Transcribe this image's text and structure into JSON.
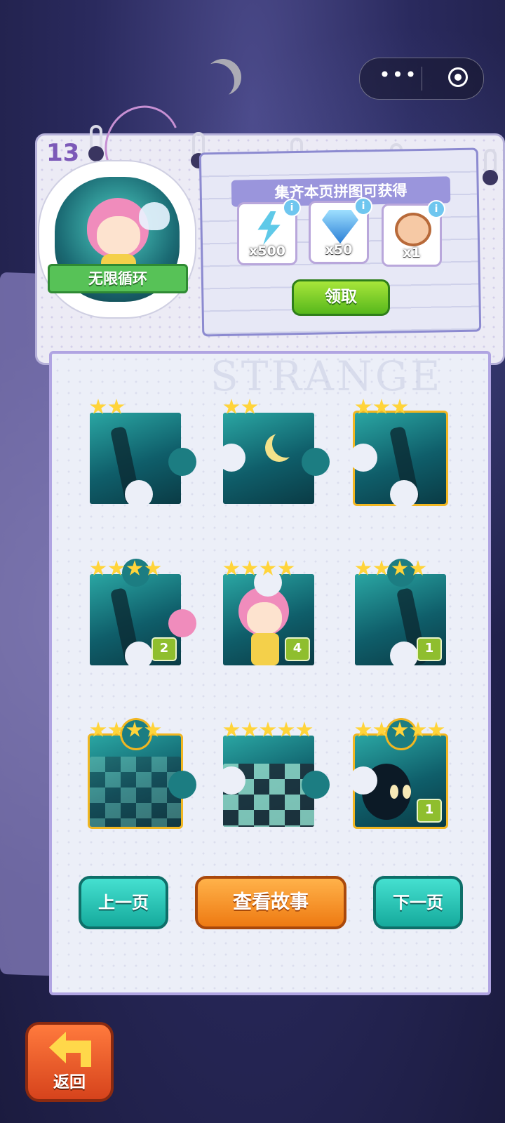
{
  "header": {
    "page_number": "13",
    "badge_title": "无限循环"
  },
  "rewards": {
    "title": "集齐本页拼图可获得",
    "items": [
      {
        "icon": "lightning-energy-icon",
        "quantity": "x500",
        "info": "i"
      },
      {
        "icon": "diamond-icon",
        "quantity": "x50",
        "info": "i"
      },
      {
        "icon": "alarm-clock-icon",
        "quantity": "x1",
        "info": "i"
      }
    ],
    "claim_label": "领取"
  },
  "puzzle": {
    "watermark": "STRANGE",
    "pieces": [
      {
        "stars": 2,
        "count": ""
      },
      {
        "stars": 2,
        "count": ""
      },
      {
        "stars": 3,
        "count": ""
      },
      {
        "stars": 4,
        "count": "2"
      },
      {
        "stars": 4,
        "count": "4"
      },
      {
        "stars": 4,
        "count": "1"
      },
      {
        "stars": 4,
        "count": ""
      },
      {
        "stars": 5,
        "count": ""
      },
      {
        "stars": 5,
        "count": "1"
      }
    ]
  },
  "navigation": {
    "prev_label": "上一页",
    "story_label": "查看故事",
    "next_label": "下一页",
    "back_label": "返回"
  },
  "colors": {
    "teal_button": "#15aa9c",
    "orange_button": "#ee7a12",
    "claim_green": "#57b81c",
    "star_yellow": "#ffd43a",
    "count_badge": "#8fbe2e"
  }
}
